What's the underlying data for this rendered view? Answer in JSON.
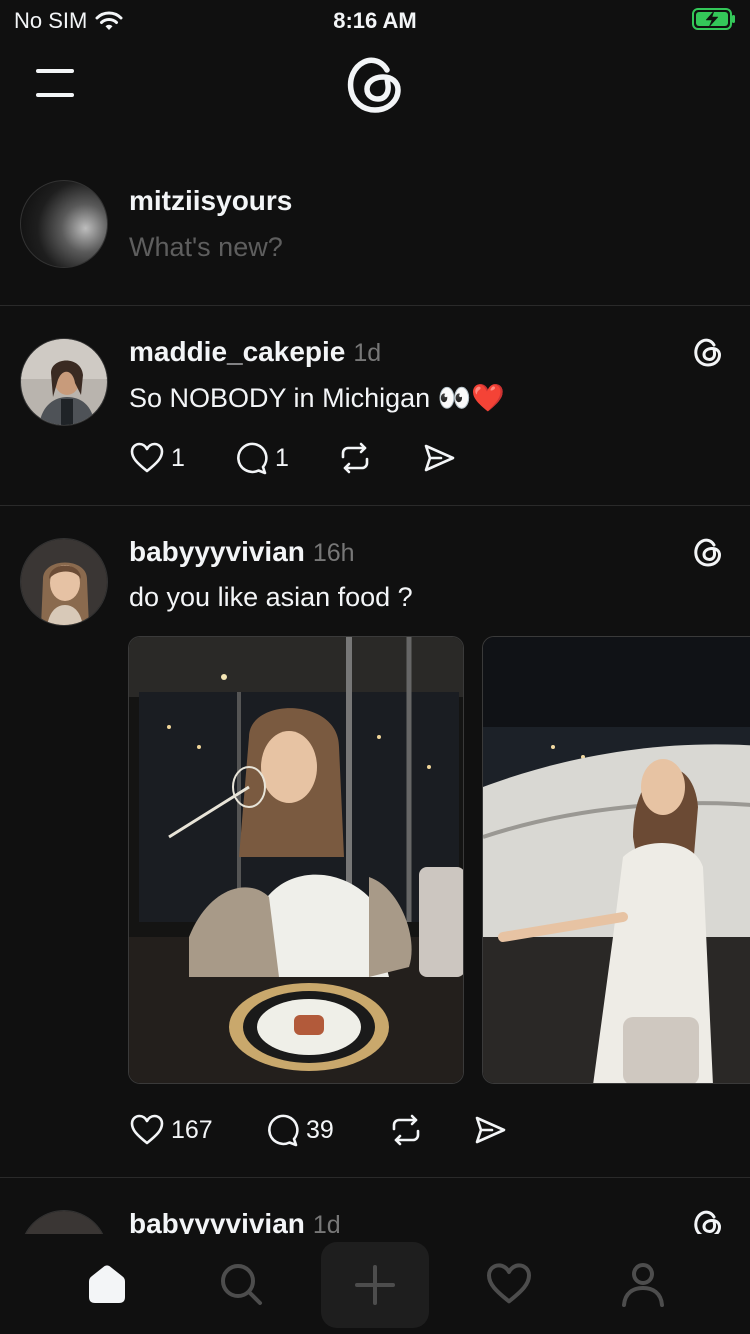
{
  "status_bar": {
    "carrier": "No SIM",
    "time": "8:16 AM"
  },
  "composer": {
    "username": "mitziisyours",
    "placeholder": "What's new?"
  },
  "posts": [
    {
      "username": "maddie_cakepie",
      "time": "1d",
      "text": "So NOBODY in Michigan 👀❤️",
      "likes": "1",
      "replies": "1"
    },
    {
      "username": "babyyyvivian",
      "time": "16h",
      "text": "do you like asian food ?",
      "likes": "167",
      "replies": "39"
    },
    {
      "username": "babyyyvivian",
      "time": "1d"
    }
  ],
  "colors": {
    "background": "#101010",
    "text": "#f3f5f7",
    "muted": "#777777",
    "battery": "#34c759",
    "like": "#ff3040"
  },
  "icons": [
    "menu-icon",
    "threads-logo-icon",
    "heart-icon",
    "comment-icon",
    "repost-icon",
    "share-icon",
    "home-icon",
    "search-icon",
    "plus-icon",
    "profile-icon"
  ]
}
